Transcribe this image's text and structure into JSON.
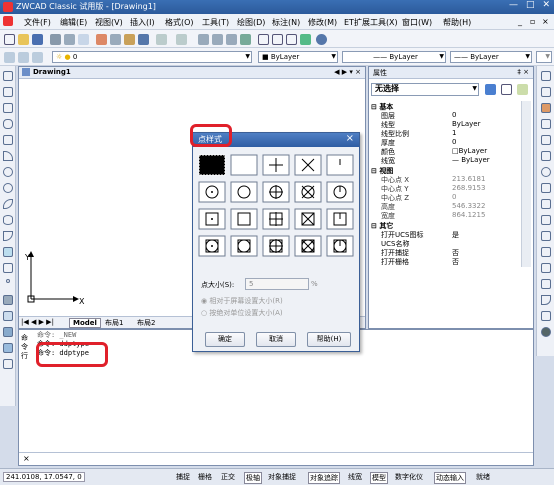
{
  "app": {
    "title": "ZWCAD Classic 试用版 - [Drawing1]",
    "win_controls": [
      "—",
      "□",
      "✕"
    ],
    "doc_controls": [
      "_",
      "▫",
      "×"
    ]
  },
  "menu": [
    "文件(F)",
    "编辑(E)",
    "视图(V)",
    "插入(I)",
    "格式(O)",
    "工具(T)",
    "绘图(D)",
    "标注(N)",
    "修改(M)",
    "ET扩展工具(X)",
    "窗口(W)",
    "帮助(H)"
  ],
  "layer_bar": {
    "layer_value": "0",
    "color": "ByLayer",
    "linetype": "ByLayer",
    "lineweight": "ByLayer",
    "plotstyle": "ByLayer"
  },
  "drawing": {
    "tab_title": "Drawing1",
    "nav": "◀ ▶ ▾ ×",
    "axis_y": "Y",
    "axis_x": "X",
    "tabs": [
      "Model",
      "布局1",
      "布局2"
    ],
    "tab_nav": "|◀ ◀ ▶ ▶|"
  },
  "properties": {
    "title": "属性",
    "pin": "‡ ×",
    "selection": "无选择",
    "groups": [
      {
        "name": "基本",
        "rows": [
          [
            "图层",
            "0"
          ],
          [
            "线型",
            "ByLayer"
          ],
          [
            "线型比例",
            "1"
          ],
          [
            "厚度",
            "0"
          ],
          [
            "颜色",
            "□ByLayer"
          ],
          [
            "线宽",
            "— ByLayer"
          ]
        ]
      },
      {
        "name": "视图",
        "rows": [
          [
            "中心点 X",
            "213.6181"
          ],
          [
            "中心点 Y",
            "268.9153"
          ],
          [
            "中心点 Z",
            "0"
          ],
          [
            "高度",
            "546.3322"
          ],
          [
            "宽度",
            "864.1215"
          ]
        ]
      },
      {
        "name": "其它",
        "rows": [
          [
            "打开UCS图标",
            "是"
          ],
          [
            "UCS名称",
            ""
          ],
          [
            "打开捕捉",
            "否"
          ],
          [
            "打开栅格",
            "否"
          ]
        ]
      }
    ]
  },
  "command": {
    "lines": [
      "命令: _NEW",
      "命令: ddptype",
      "命令: ddptype"
    ],
    "side_label": "命令行"
  },
  "dialog": {
    "title": "点样式",
    "close": "×",
    "size_label": "点大小(S):",
    "size_value": "5",
    "unit": "%",
    "opt1": "相对于屏幕设置大小(R)",
    "opt2": "按绝对单位设置大小(A)",
    "ok": "确定",
    "cancel": "取消",
    "help": "帮助(H)",
    "styles": [
      "point",
      "blank",
      "plus",
      "cross",
      "tick",
      "circle",
      "circle-blank",
      "circle-plus",
      "circle-cross",
      "circle-tick",
      "square",
      "square-blank",
      "square-plus",
      "square-cross",
      "square-tick",
      "cs",
      "cs-blank",
      "cs-plus",
      "cs-cross",
      "cs-tick"
    ],
    "selected": 0
  },
  "status": {
    "coords": "241.0108,  17.0547,  0",
    "buttons": [
      "捕捉",
      "栅格",
      "正交",
      "极轴",
      "对象捕捉",
      "对象追踪",
      "线宽",
      "模型",
      "数字化仪",
      "动态输入",
      "就绪"
    ]
  },
  "colors": {
    "accent": "#2f5da3",
    "highlight": "#e0202a"
  }
}
